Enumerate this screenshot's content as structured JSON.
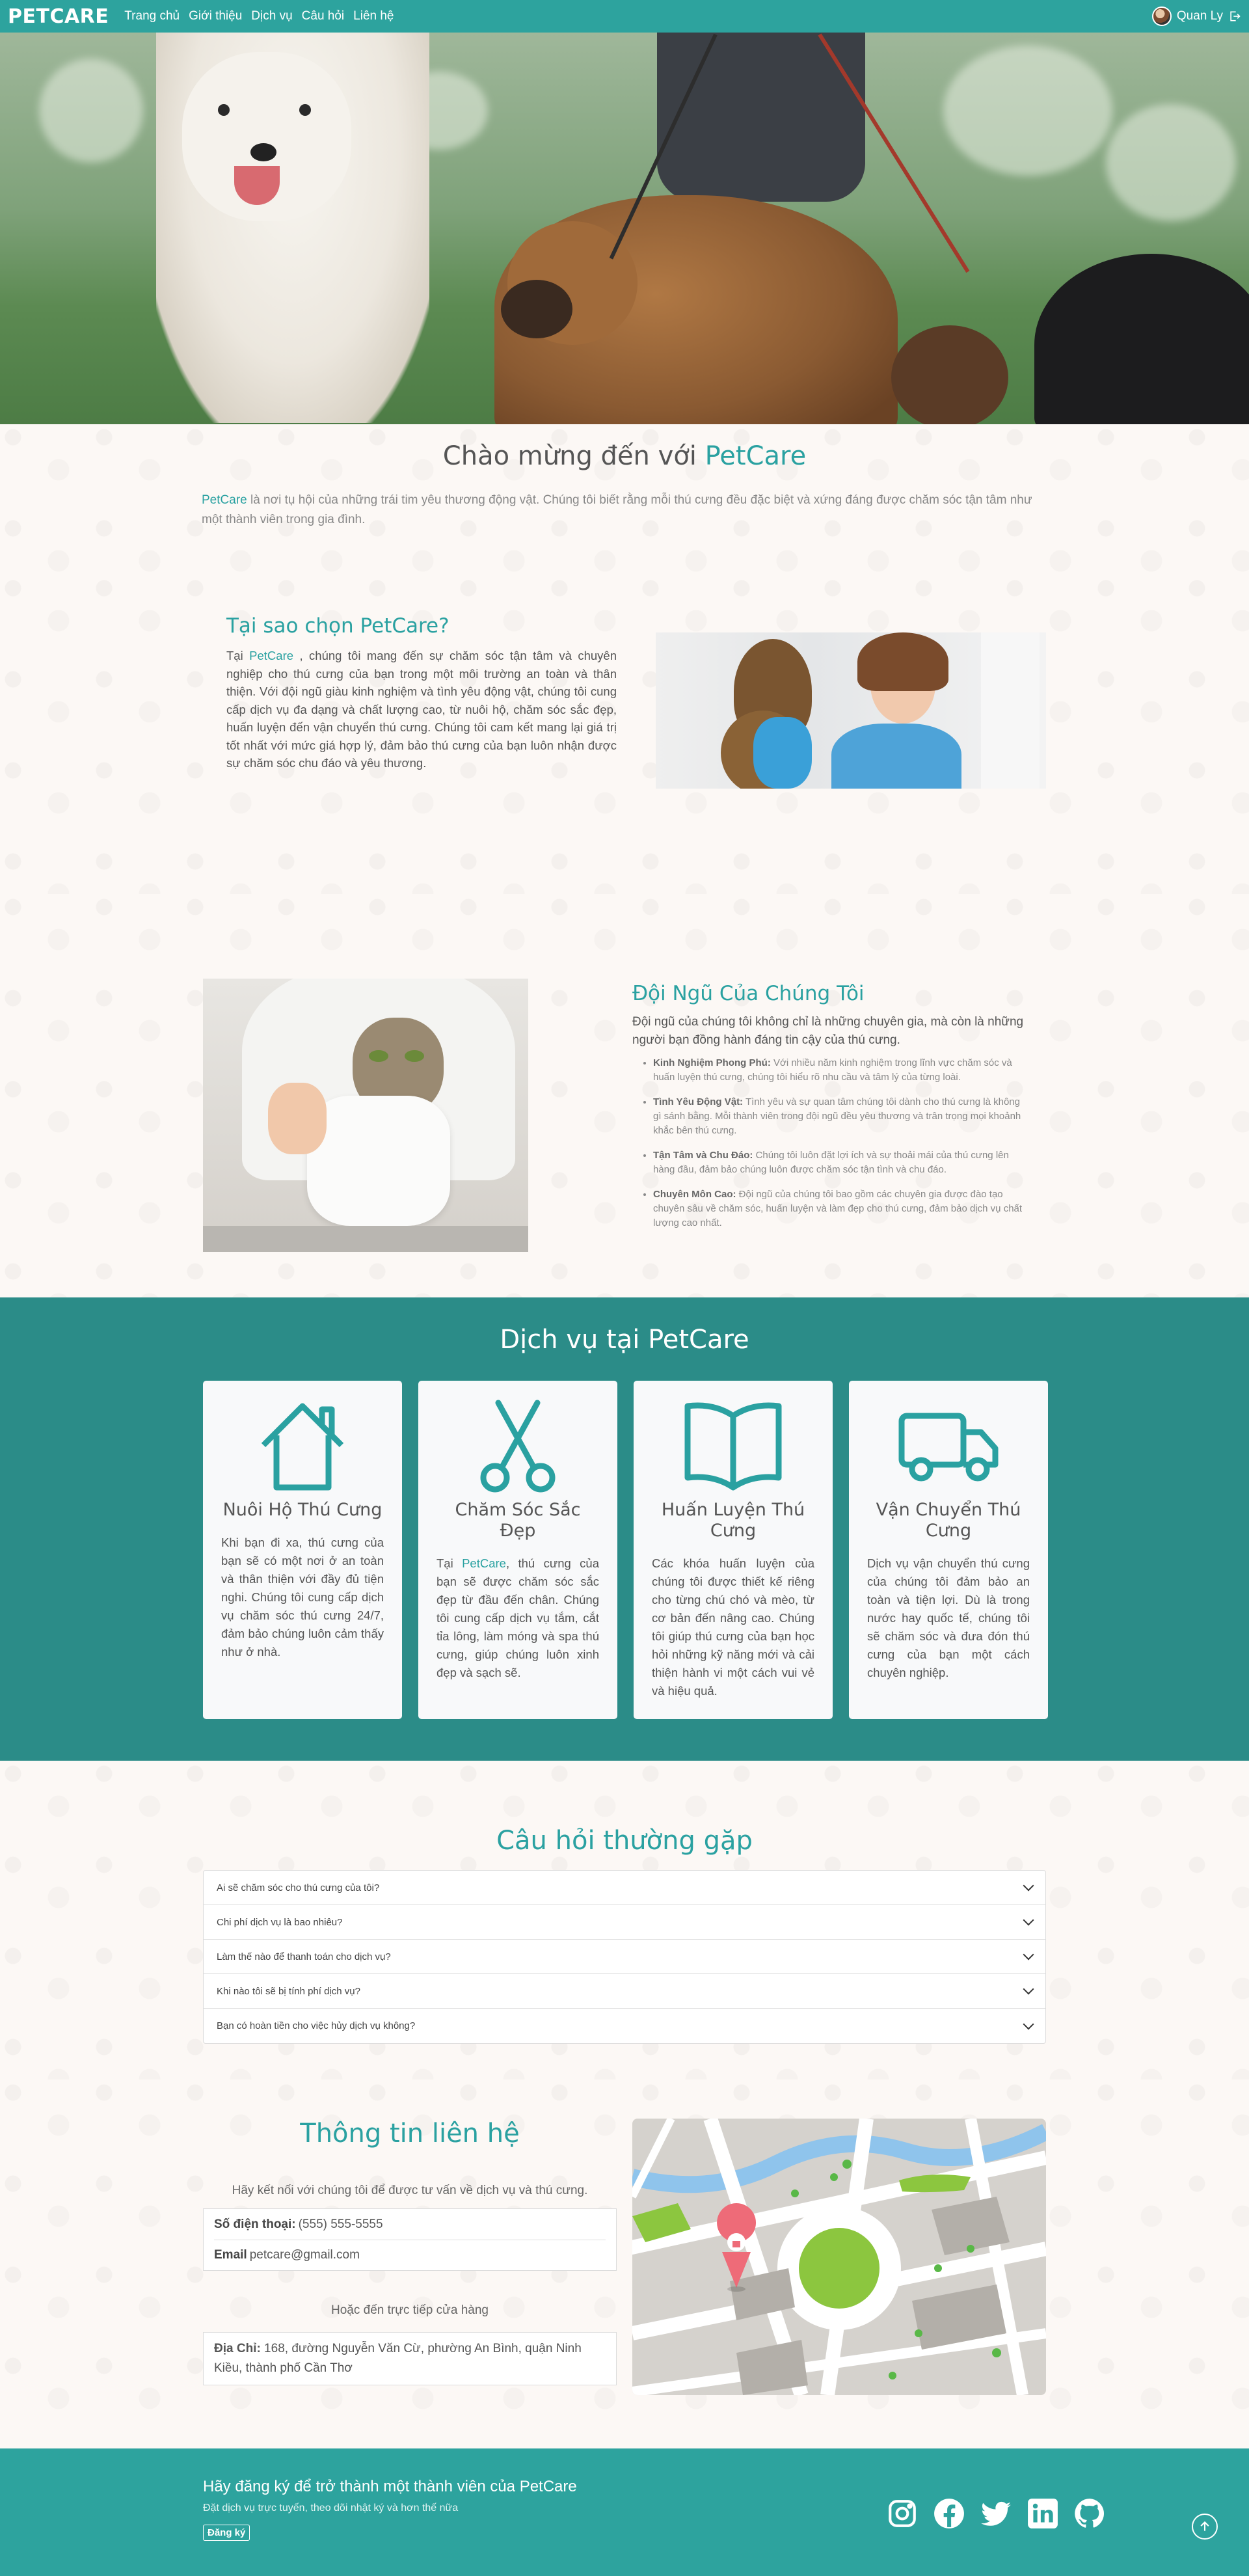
{
  "nav": {
    "brand": "PETCARE",
    "links": [
      "Trang chủ",
      "Giới thiệu",
      "Dịch vụ",
      "Câu hỏi",
      "Liên hệ"
    ],
    "user_name": "Quan Ly",
    "logout_icon": "logout-icon"
  },
  "welcome": {
    "title_prefix": "Chào mừng đến với ",
    "title_brand": "PetCare",
    "text_brand": "PetCare",
    "text": " là nơi tụ hội của những trái tim yêu thương động vật. Chúng tôi biết rằng mỗi thú cưng đều đặc biệt và xứng đáng được chăm sóc tận tâm như một thành viên trong gia đình."
  },
  "why": {
    "title": "Tại sao chọn PetCare?",
    "text_prefix": "Tại ",
    "text_brand": "PetCare",
    "text": " , chúng tôi mang đến sự chăm sóc tận tâm và chuyên nghiệp cho thú cưng của bạn trong một môi trường an toàn và thân thiện. Với đội ngũ giàu kinh nghiệm và tình yêu động vật, chúng tôi cung cấp dịch vụ đa dạng và chất lượng cao, từ nuôi hộ, chăm sóc sắc đẹp, huấn luyện đến vận chuyển thú cưng. Chúng tôi cam kết mang lại giá trị tốt nhất với mức giá hợp lý, đảm bảo thú cưng của bạn luôn nhận được sự chăm sóc chu đáo và yêu thương."
  },
  "team": {
    "title": "Đội Ngũ Của Chúng Tôi",
    "intro": "Đội ngũ của chúng tôi không chỉ là những chuyên gia, mà còn là những người bạn đồng hành đáng tin cậy của thú cưng.",
    "items": [
      {
        "label": "Kinh Nghiệm Phong Phú:",
        "text": " Với nhiều năm kinh nghiệm trong lĩnh vực chăm sóc và huấn luyện thú cưng, chúng tôi hiểu rõ nhu cầu và tâm lý của từng loài."
      },
      {
        "label": "Tình Yêu Động Vật:",
        "text": " Tình yêu và sự quan tâm chúng tôi dành cho thú cưng là không gì sánh bằng. Mỗi thành viên trong đội ngũ đều yêu thương và trân trọng mọi khoảnh khắc bên thú cưng."
      },
      {
        "label": "Tận Tâm và Chu Đáo:",
        "text": " Chúng tôi luôn đặt lợi ích và sự thoải mái của thú cưng lên hàng đầu, đảm bảo chúng luôn được chăm sóc tận tình và chu đáo."
      },
      {
        "label": "Chuyên Môn Cao:",
        "text": " Đội ngũ của chúng tôi bao gồm các chuyên gia được đào tạo chuyên sâu về chăm sóc, huấn luyện và làm đẹp cho thú cưng, đảm bảo dịch vụ chất lượng cao nhất."
      }
    ]
  },
  "services": {
    "title": "Dịch vụ tại PetCare",
    "cards": [
      {
        "icon": "house-icon",
        "title": "Nuôi Hộ Thú Cưng",
        "text_prefix": "",
        "text_brand": "",
        "text": "Khi bạn đi xa, thú cưng của bạn sẽ có một nơi ở an toàn và thân thiện với đầy đủ tiện nghi. Chúng tôi cung cấp dịch vụ chăm sóc thú cưng 24/7, đảm bảo chúng luôn cảm thấy như ở nhà."
      },
      {
        "icon": "scissors-icon",
        "title": "Chăm Sóc Sắc Đẹp",
        "text_prefix": "Tại ",
        "text_brand": "PetCare",
        "text": ", thú cưng của bạn sẽ được chăm sóc sắc đẹp từ đầu đến chân. Chúng tôi cung cấp dịch vụ tắm, cắt tỉa lông, làm móng và spa thú cưng, giúp chúng luôn xinh đẹp và sạch sẽ."
      },
      {
        "icon": "open-book-icon",
        "title": "Huấn Luyện Thú Cưng",
        "text_prefix": "",
        "text_brand": "",
        "text": "Các khóa huấn luyện của chúng tôi được thiết kế riêng cho từng chú chó và mèo, từ cơ bản đến nâng cao. Chúng tôi giúp thú cưng của bạn học hỏi những kỹ năng mới và cải thiện hành vi một cách vui vẻ và hiệu quả."
      },
      {
        "icon": "truck-icon",
        "title": "Vận Chuyển Thú Cưng",
        "text_prefix": "",
        "text_brand": "",
        "text": "Dịch vụ vận chuyển thú cưng của chúng tôi đảm bảo an toàn và tiện lợi. Dù là trong nước hay quốc tế, chúng tôi sẽ chăm sóc và đưa đón thú cưng của bạn một cách chuyên nghiệp."
      }
    ]
  },
  "faq": {
    "title": "Câu hỏi thường gặp",
    "items": [
      "Ai sẽ chăm sóc cho thú cưng của tôi?",
      "Chi phí dịch vụ là bao nhiêu?",
      "Làm thế nào để thanh toán cho dịch vụ?",
      "Khi nào tôi sẽ bị tính phí dịch vụ?",
      "Bạn có hoàn tiền cho việc hủy dịch vụ không?"
    ]
  },
  "contact": {
    "title": "Thông tin liên hệ",
    "subtitle": "Hãy kết nối với chúng tôi để được tư vấn về dịch vụ và thú cưng.",
    "phone_label": "Số điện thoại:",
    "phone": " (555) 555-5555",
    "email_label": "Email",
    "email": " petcare@gmail.com",
    "visit": "Hoặc đến trực tiếp cửa hàng",
    "address_label": "Địa Chỉ:",
    "address": " 168, đường Nguyễn Văn Cừ, phường An Bình, quận Ninh Kiều, thành phố Cần Thơ"
  },
  "footer": {
    "title": "Hãy đăng ký để trở thành một thành viên của PetCare",
    "subtitle": "Đặt dịch vụ trực tuyến, theo dõi nhật ký và hơn thế nữa",
    "signup": "Đăng ký",
    "socials": [
      "instagram-icon",
      "facebook-icon",
      "twitter-icon",
      "linkedin-icon",
      "github-icon"
    ]
  },
  "colors": {
    "primary": "#2da39e",
    "services_bg": "#2b8c88",
    "accent_text": "#2aa1a1"
  }
}
